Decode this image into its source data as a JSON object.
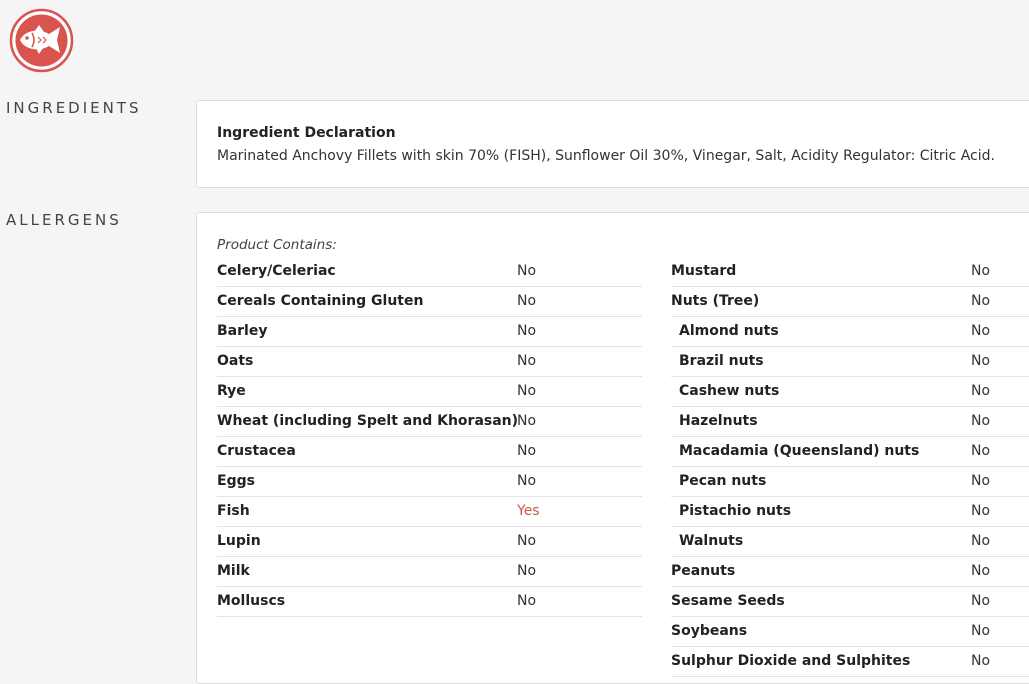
{
  "brand": {
    "icon": "fish-icon",
    "color": "#d9534f"
  },
  "sections": {
    "ingredients_label": "INGREDIENTS",
    "allergens_label": "ALLERGENS"
  },
  "ingredients": {
    "title": "Ingredient Declaration",
    "text": "Marinated Anchovy Fillets with skin 70% (FISH), Sunflower Oil 30%, Vinegar, Salt, Acidity Regulator: Citric Acid."
  },
  "allergens": {
    "contains_label": "Product Contains:",
    "left": [
      {
        "name": "Celery/Celeriac",
        "value": "No"
      },
      {
        "name": "Cereals Containing Gluten",
        "value": "No"
      },
      {
        "name": "Barley",
        "value": "No"
      },
      {
        "name": "Oats",
        "value": "No"
      },
      {
        "name": "Rye",
        "value": "No"
      },
      {
        "name": "Wheat (including Spelt and Khorasan)",
        "value": "No"
      },
      {
        "name": "Crustacea",
        "value": "No"
      },
      {
        "name": "Eggs",
        "value": "No"
      },
      {
        "name": "Fish",
        "value": "Yes"
      },
      {
        "name": "Lupin",
        "value": "No"
      },
      {
        "name": "Milk",
        "value": "No"
      },
      {
        "name": "Molluscs",
        "value": "No"
      }
    ],
    "right": [
      {
        "name": "Mustard",
        "value": "No",
        "sub": false
      },
      {
        "name": "Nuts (Tree)",
        "value": "No",
        "sub": false
      },
      {
        "name": "Almond nuts",
        "value": "No",
        "sub": true
      },
      {
        "name": "Brazil nuts",
        "value": "No",
        "sub": true
      },
      {
        "name": "Cashew nuts",
        "value": "No",
        "sub": true
      },
      {
        "name": "Hazelnuts",
        "value": "No",
        "sub": true
      },
      {
        "name": "Macadamia (Queensland) nuts",
        "value": "No",
        "sub": true
      },
      {
        "name": "Pecan nuts",
        "value": "No",
        "sub": true
      },
      {
        "name": "Pistachio nuts",
        "value": "No",
        "sub": true
      },
      {
        "name": "Walnuts",
        "value": "No",
        "sub": true
      },
      {
        "name": "Peanuts",
        "value": "No",
        "sub": false
      },
      {
        "name": "Sesame Seeds",
        "value": "No",
        "sub": false
      },
      {
        "name": "Soybeans",
        "value": "No",
        "sub": false
      },
      {
        "name": "Sulphur Dioxide and Sulphites",
        "value": "No",
        "sub": false
      }
    ]
  }
}
